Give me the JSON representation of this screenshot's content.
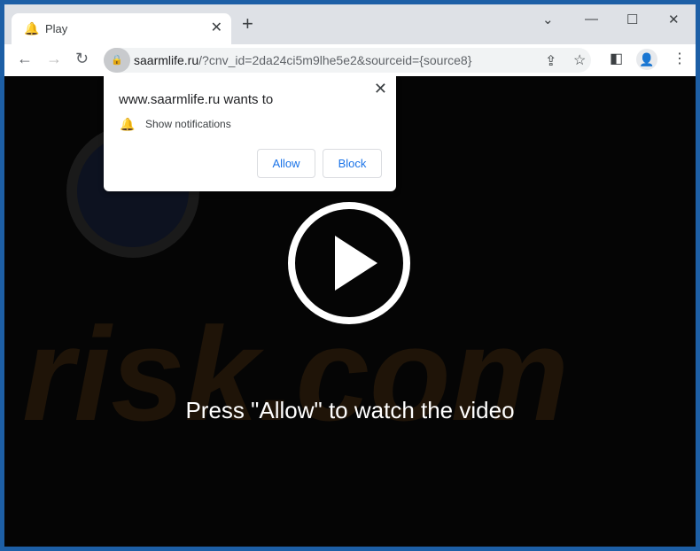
{
  "tab": {
    "title": "Play",
    "favicon": "bell-favicon-icon"
  },
  "address": {
    "domain": "saarmlife.ru",
    "path": "/?cnv_id=2da24ci5m9lhe5e2&sourceid={source8}"
  },
  "popup": {
    "heading": "www.saarmlife.ru wants to",
    "permission": "Show notifications",
    "allow_label": "Allow",
    "block_label": "Block"
  },
  "content": {
    "message": "Press \"Allow\" to watch the video",
    "watermark": "risk.com"
  },
  "colors": {
    "frame": "#1d5fa6",
    "tabbar": "#dee1e6",
    "accent": "#1a73e8"
  }
}
